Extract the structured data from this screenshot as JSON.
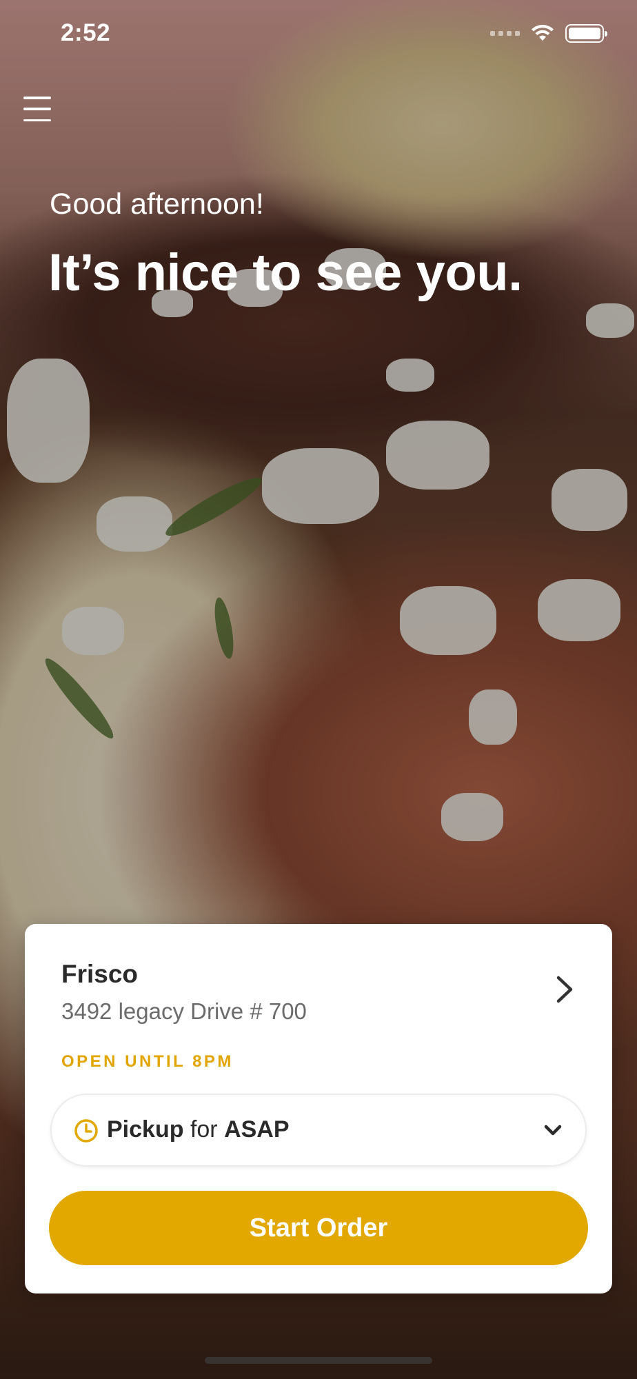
{
  "status_bar": {
    "time": "2:52",
    "icons": [
      "cellular-signal-icon",
      "wifi-icon",
      "battery-icon"
    ]
  },
  "menu": {
    "icon": "hamburger-menu-icon"
  },
  "greeting": {
    "subtitle": "Good afternoon!",
    "title": "It’s nice to see you."
  },
  "location": {
    "name": "Frisco",
    "address": "3492 legacy Drive # 700",
    "hours_status": "OPEN UNTIL 8PM",
    "icon": "chevron-right-icon"
  },
  "order_mode": {
    "mode": "Pickup",
    "connector": "for",
    "time": "ASAP",
    "icon": "clock-icon",
    "dropdown_icon": "chevron-down-icon"
  },
  "actions": {
    "start_order_label": "Start Order"
  },
  "colors": {
    "accent": "#E2A800",
    "text_primary": "#2A2A2A",
    "text_secondary": "#6B6B6B",
    "card_background": "#FFFFFF"
  }
}
